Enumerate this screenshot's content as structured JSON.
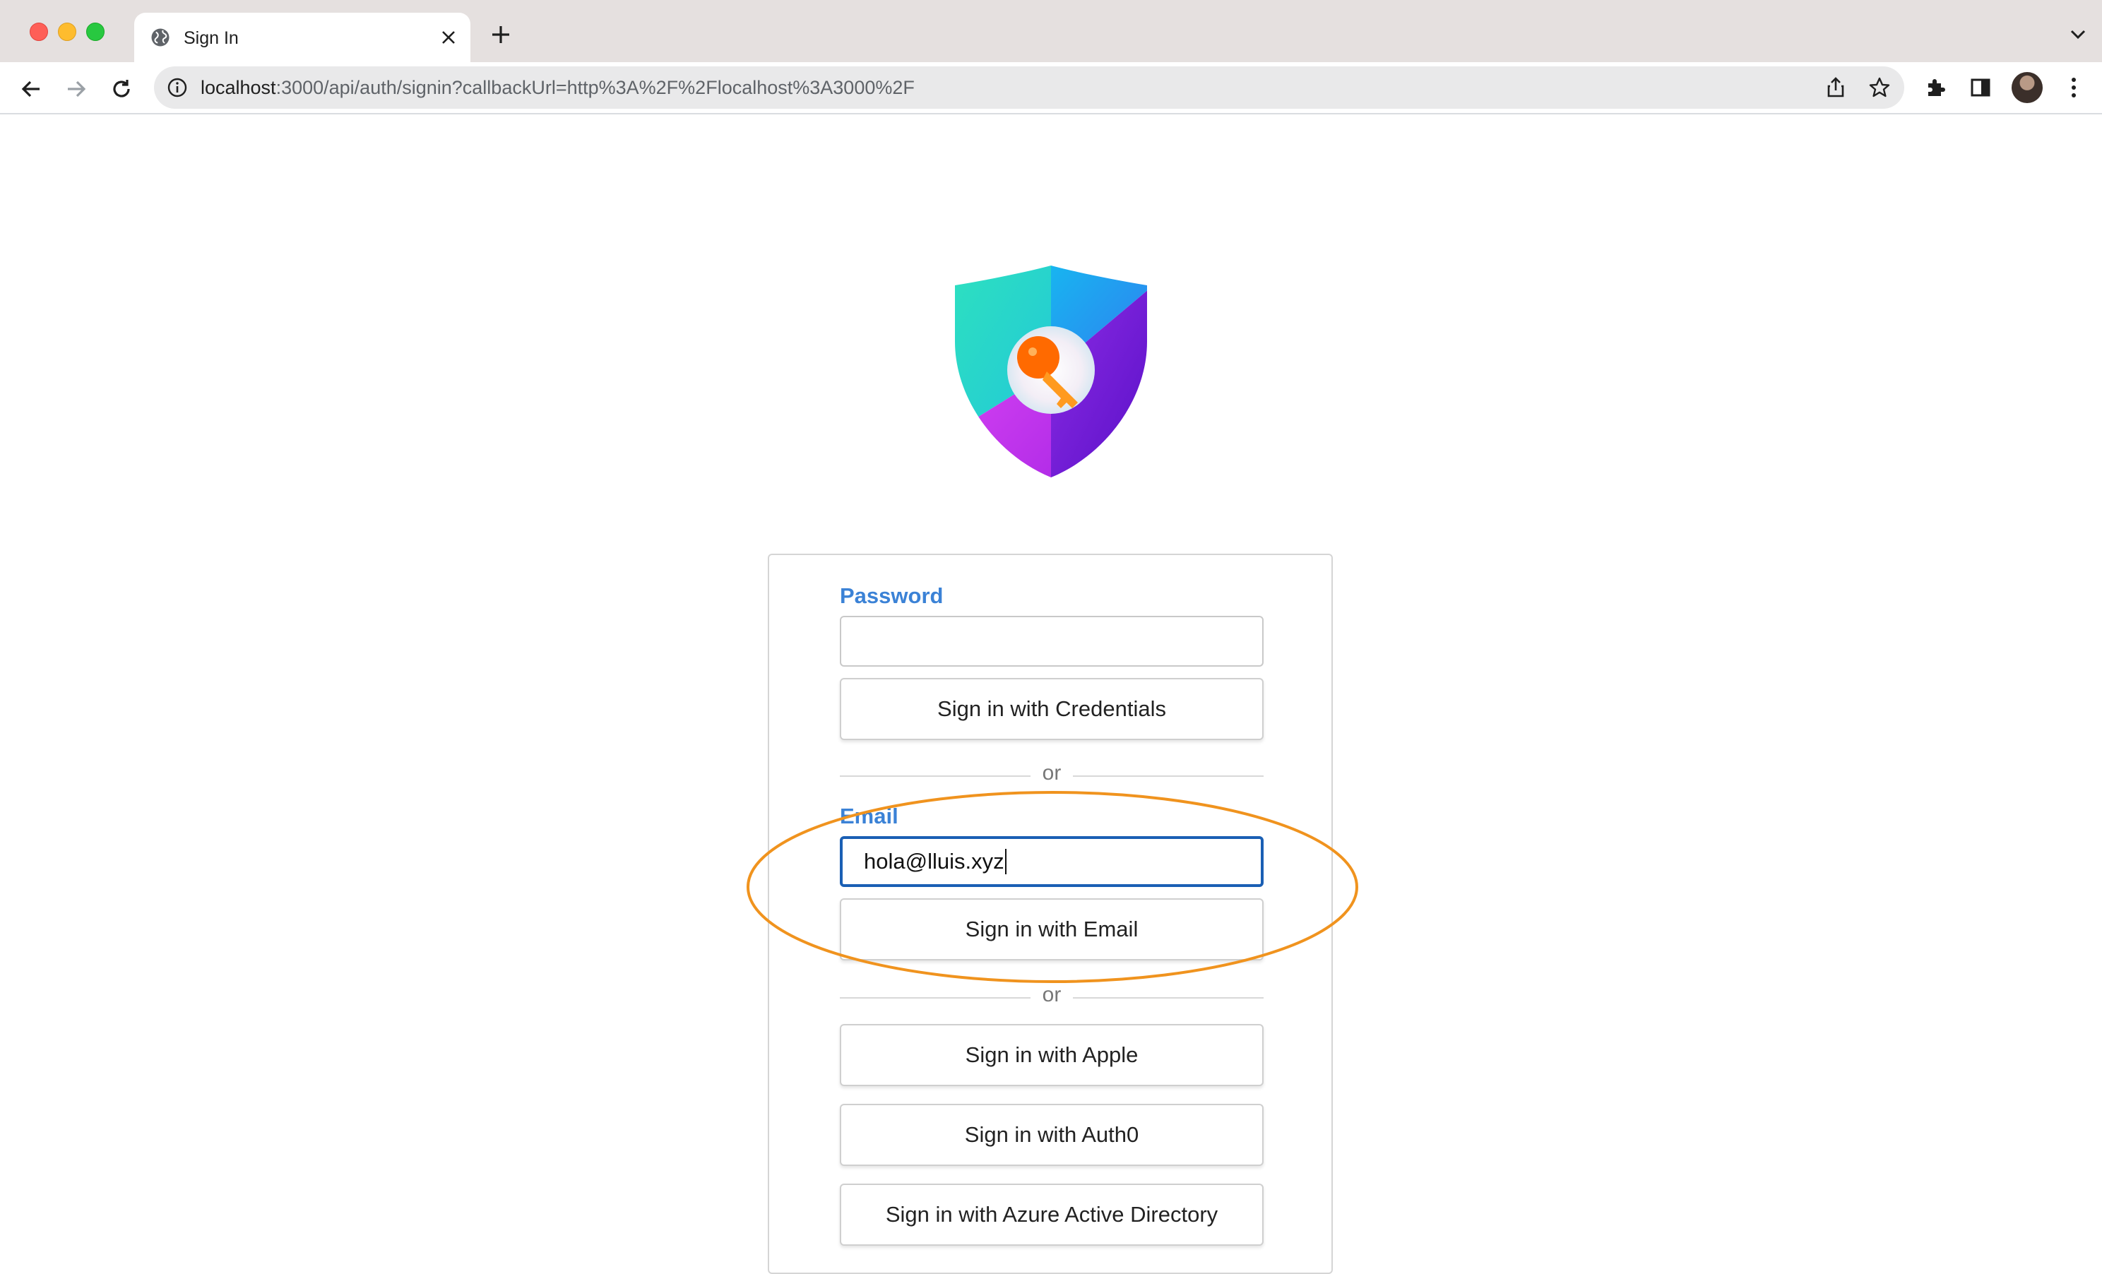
{
  "browser": {
    "tab_title": "Sign In",
    "url_host": "localhost",
    "url_rest": ":3000/api/auth/signin?callbackUrl=http%3A%2F%2Flocalhost%3A3000%2F",
    "icons": {
      "window_controls": [
        "close",
        "minimize",
        "maximize"
      ],
      "tab": [
        "globe-icon",
        "close-icon"
      ],
      "toolbar": [
        "back-arrow-icon",
        "forward-arrow-icon",
        "reload-icon",
        "info-icon",
        "share-icon",
        "star-icon",
        "extensions-puzzle-icon",
        "side-panel-icon",
        "avatar",
        "kebab-menu-icon"
      ]
    }
  },
  "logo": {
    "name": "shield-key-logo",
    "colors": [
      "#25e0bf",
      "#1eaaf1",
      "#c53bf0",
      "#7a16d6",
      "#ff7a00"
    ]
  },
  "form": {
    "password": {
      "label": "Password",
      "value": ""
    },
    "credentials_button": "Sign in with Credentials",
    "divider_1": "or",
    "email": {
      "label": "Email",
      "value": "hola@lluis.xyz"
    },
    "email_button": "Sign in with Email",
    "divider_2": "or",
    "providers": [
      "Sign in with Apple",
      "Sign in with Auth0",
      "Sign in with Azure Active Directory"
    ]
  },
  "colors": {
    "label_blue": "#3b82d6",
    "focus_border": "#1a5fb4",
    "annotation_orange": "#f0931e"
  }
}
